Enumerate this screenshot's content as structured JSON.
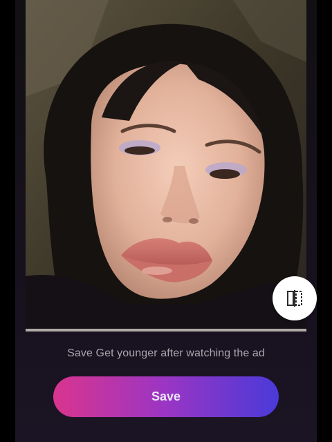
{
  "photo": {
    "description_icon": "portrait-photo"
  },
  "compare": {
    "icon": "compare-split-icon"
  },
  "caption": {
    "text": "Save Get younger after watching the ad"
  },
  "save_button": {
    "label": "Save"
  },
  "colors": {
    "background": "#121013",
    "button_gradient_start": "#d9358e",
    "button_gradient_end": "#4a3ad8",
    "caption_text": "#a9a6ad"
  }
}
